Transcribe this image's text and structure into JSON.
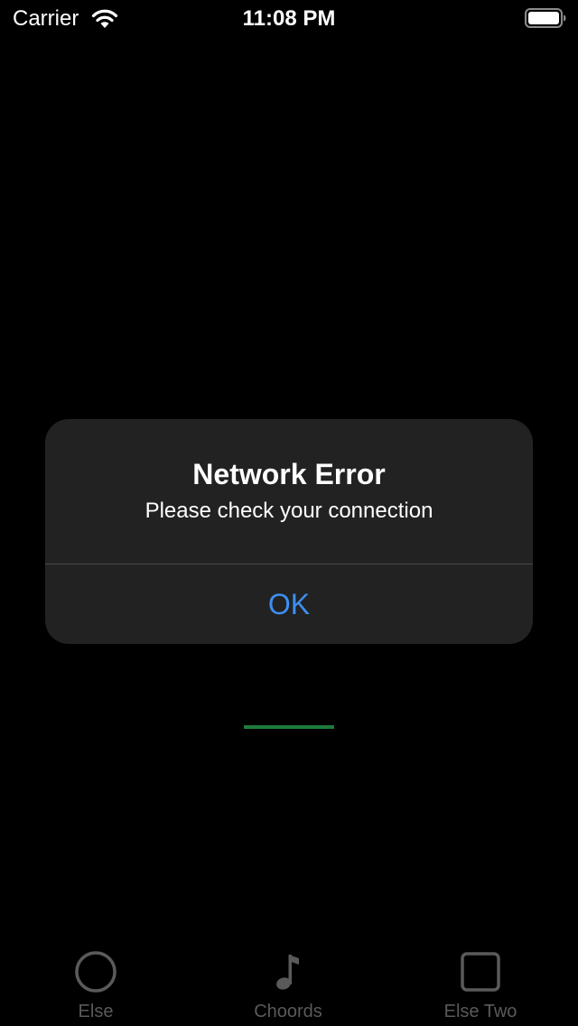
{
  "status_bar": {
    "carrier": "Carrier",
    "time": "11:08 PM",
    "wifi_icon": "wifi-icon",
    "battery_icon": "battery-icon"
  },
  "alert": {
    "title": "Network Error",
    "message": "Please check your connection",
    "ok_label": "OK",
    "button_color": "#3d8ff0"
  },
  "progress": {
    "color": "#1e7a3c"
  },
  "tab_bar": {
    "tabs": [
      {
        "label": "Else",
        "icon": "circle-icon"
      },
      {
        "label": "Choords",
        "icon": "music-note-icon"
      },
      {
        "label": "Else Two",
        "icon": "square-icon"
      }
    ],
    "inactive_color": "#5a5a5c"
  }
}
